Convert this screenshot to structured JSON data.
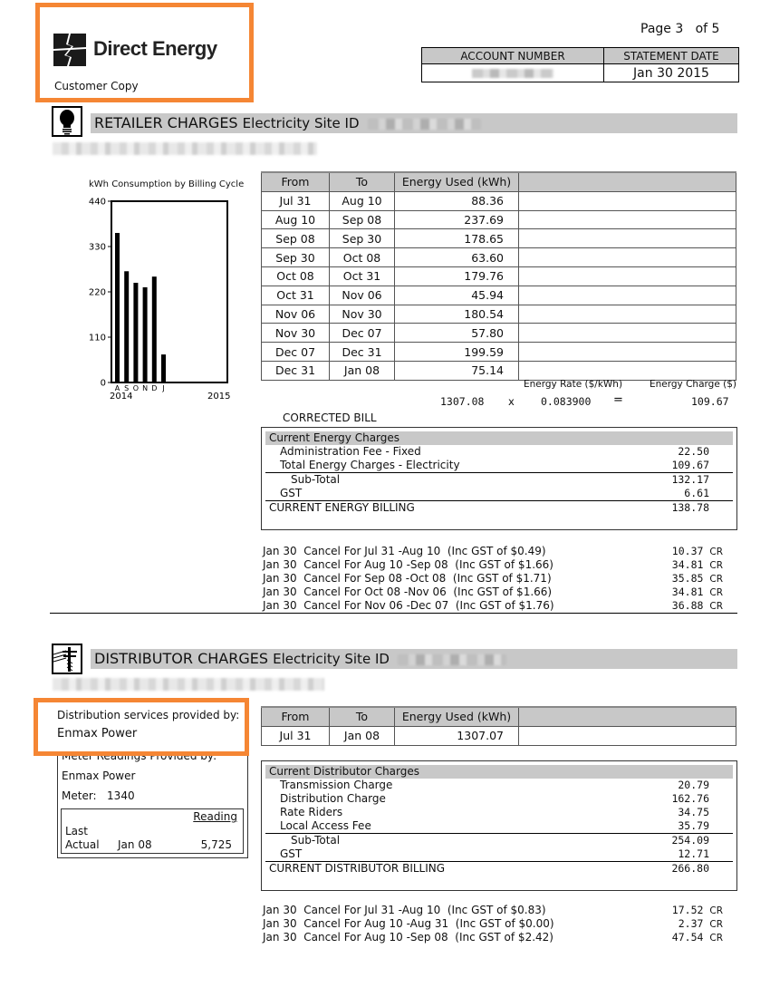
{
  "header": {
    "brand_name": "Direct Energy",
    "copy_label": "Customer Copy",
    "page_label": "Page 3",
    "page_of": "of 5",
    "account_number_label": "ACCOUNT NUMBER",
    "account_number_value": "",
    "statement_date_label": "STATEMENT DATE",
    "statement_date_value": "Jan 30 2015",
    "highlight_color": "#f58634"
  },
  "retailer": {
    "section_title": "RETAILER CHARGES",
    "site_id_label": "Electricity Site ID",
    "icon": "lightbulb-icon",
    "usage_table": {
      "columns": [
        "From",
        "To",
        "Energy Used (kWh)",
        ""
      ],
      "rows": [
        {
          "from": "Jul 31",
          "to": "Aug 10",
          "kwh": "88.36"
        },
        {
          "from": "Aug 10",
          "to": "Sep 08",
          "kwh": "237.69"
        },
        {
          "from": "Sep 08",
          "to": "Sep 30",
          "kwh": "178.65"
        },
        {
          "from": "Sep 30",
          "to": "Oct 08",
          "kwh": "63.60"
        },
        {
          "from": "Oct 08",
          "to": "Oct 31",
          "kwh": "179.76"
        },
        {
          "from": "Oct 31",
          "to": "Nov 06",
          "kwh": "45.94"
        },
        {
          "from": "Nov 06",
          "to": "Nov 30",
          "kwh": "180.54"
        },
        {
          "from": "Nov 30",
          "to": "Dec 07",
          "kwh": "57.80"
        },
        {
          "from": "Dec 07",
          "to": "Dec 31",
          "kwh": "199.59"
        },
        {
          "from": "Dec 31",
          "to": "Jan 08",
          "kwh": "75.14"
        }
      ]
    },
    "rate": {
      "rate_label": "Energy Rate ($/kWh)",
      "charge_label": "Energy Charge ($)",
      "kwh_total": "1307.08",
      "times": "x",
      "rate_value": "0.083900",
      "equals": "=",
      "charge_value": "109.67"
    },
    "corrected_label": "CORRECTED BILL",
    "charges": {
      "heading": "Current Energy Charges",
      "rows": [
        {
          "label": "Administration Fee - Fixed",
          "amount": "22.50"
        },
        {
          "label": "Total Energy Charges - Electricity",
          "amount": "109.67"
        },
        {
          "label": "Sub-Total",
          "amount": "132.17"
        },
        {
          "label": "GST",
          "amount": "6.61"
        },
        {
          "label": "CURRENT ENERGY BILLING",
          "amount": "138.78"
        }
      ]
    },
    "credits": [
      {
        "date": "Jan 30",
        "desc": "Cancel For Jul 31 -Aug 10  (Inc GST of $0.49)",
        "amount": "10.37",
        "suffix": "CR"
      },
      {
        "date": "Jan 30",
        "desc": "Cancel For Aug 10 -Sep 08  (Inc GST of $1.66)",
        "amount": "34.81",
        "suffix": "CR"
      },
      {
        "date": "Jan 30",
        "desc": "Cancel For Sep 08 -Oct 08  (Inc GST of $1.71)",
        "amount": "35.85",
        "suffix": "CR"
      },
      {
        "date": "Jan 30",
        "desc": "Cancel For Oct 08 -Nov 06  (Inc GST of $1.66)",
        "amount": "34.81",
        "suffix": "CR"
      },
      {
        "date": "Jan 30",
        "desc": "Cancel For Nov 06 -Dec 07  (Inc GST of $1.76)",
        "amount": "36.88",
        "suffix": "CR"
      }
    ]
  },
  "chart_data": {
    "type": "bar",
    "title": "kWh Consumption by Billing Cycle",
    "categories": [
      "A",
      "S",
      "O",
      "N",
      "D",
      "J"
    ],
    "values": [
      363,
      270,
      242,
      231,
      257,
      68
    ],
    "yticks": [
      "0",
      "110",
      "220",
      "330",
      "440"
    ],
    "ylim": [
      0,
      440
    ],
    "xlabel_years": [
      "2014",
      "2015"
    ],
    "xlabel": "",
    "ylabel": "",
    "grid": false
  },
  "distributor": {
    "section_title": "DISTRIBUTOR CHARGES",
    "site_id_label": "Electricity Site ID",
    "icon": "power-pole-icon",
    "provided_by_label": "Distribution services provided by:",
    "provider_name": "Enmax Power",
    "meter_readings_label": "Meter Readings Provided by:",
    "meter_provider": "Enmax Power",
    "meter_label": "Meter:",
    "meter_number": "1340",
    "reading_header": "Reading",
    "reading_type_1": "Last",
    "reading_type_2": "Actual",
    "reading_date": "Jan 08",
    "reading_value": "5,725",
    "usage_table": {
      "columns": [
        "From",
        "To",
        "Energy Used (kWh)",
        ""
      ],
      "rows": [
        {
          "from": "Jul 31",
          "to": "Jan 08",
          "kwh": "1307.07"
        }
      ]
    },
    "charges": {
      "heading": "Current Distributor Charges",
      "rows": [
        {
          "label": "Transmission Charge",
          "amount": "20.79"
        },
        {
          "label": "Distribution Charge",
          "amount": "162.76"
        },
        {
          "label": "Rate Riders",
          "amount": "34.75"
        },
        {
          "label": "Local Access Fee",
          "amount": "35.79"
        },
        {
          "label": "Sub-Total",
          "amount": "254.09"
        },
        {
          "label": "GST",
          "amount": "12.71"
        },
        {
          "label": "CURRENT DISTRIBUTOR BILLING",
          "amount": "266.80"
        }
      ]
    },
    "credits": [
      {
        "date": "Jan 30",
        "desc": "Cancel For Jul 31 -Aug 10  (Inc GST of $0.83)",
        "amount": "17.52",
        "suffix": "CR"
      },
      {
        "date": "Jan 30",
        "desc": "Cancel For Aug 10 -Aug 31  (Inc GST of $0.00)",
        "amount": "2.37",
        "suffix": "CR"
      },
      {
        "date": "Jan 30",
        "desc": "Cancel For Aug 10 -Sep 08  (Inc GST of $2.42)",
        "amount": "47.54",
        "suffix": "CR"
      }
    ]
  }
}
